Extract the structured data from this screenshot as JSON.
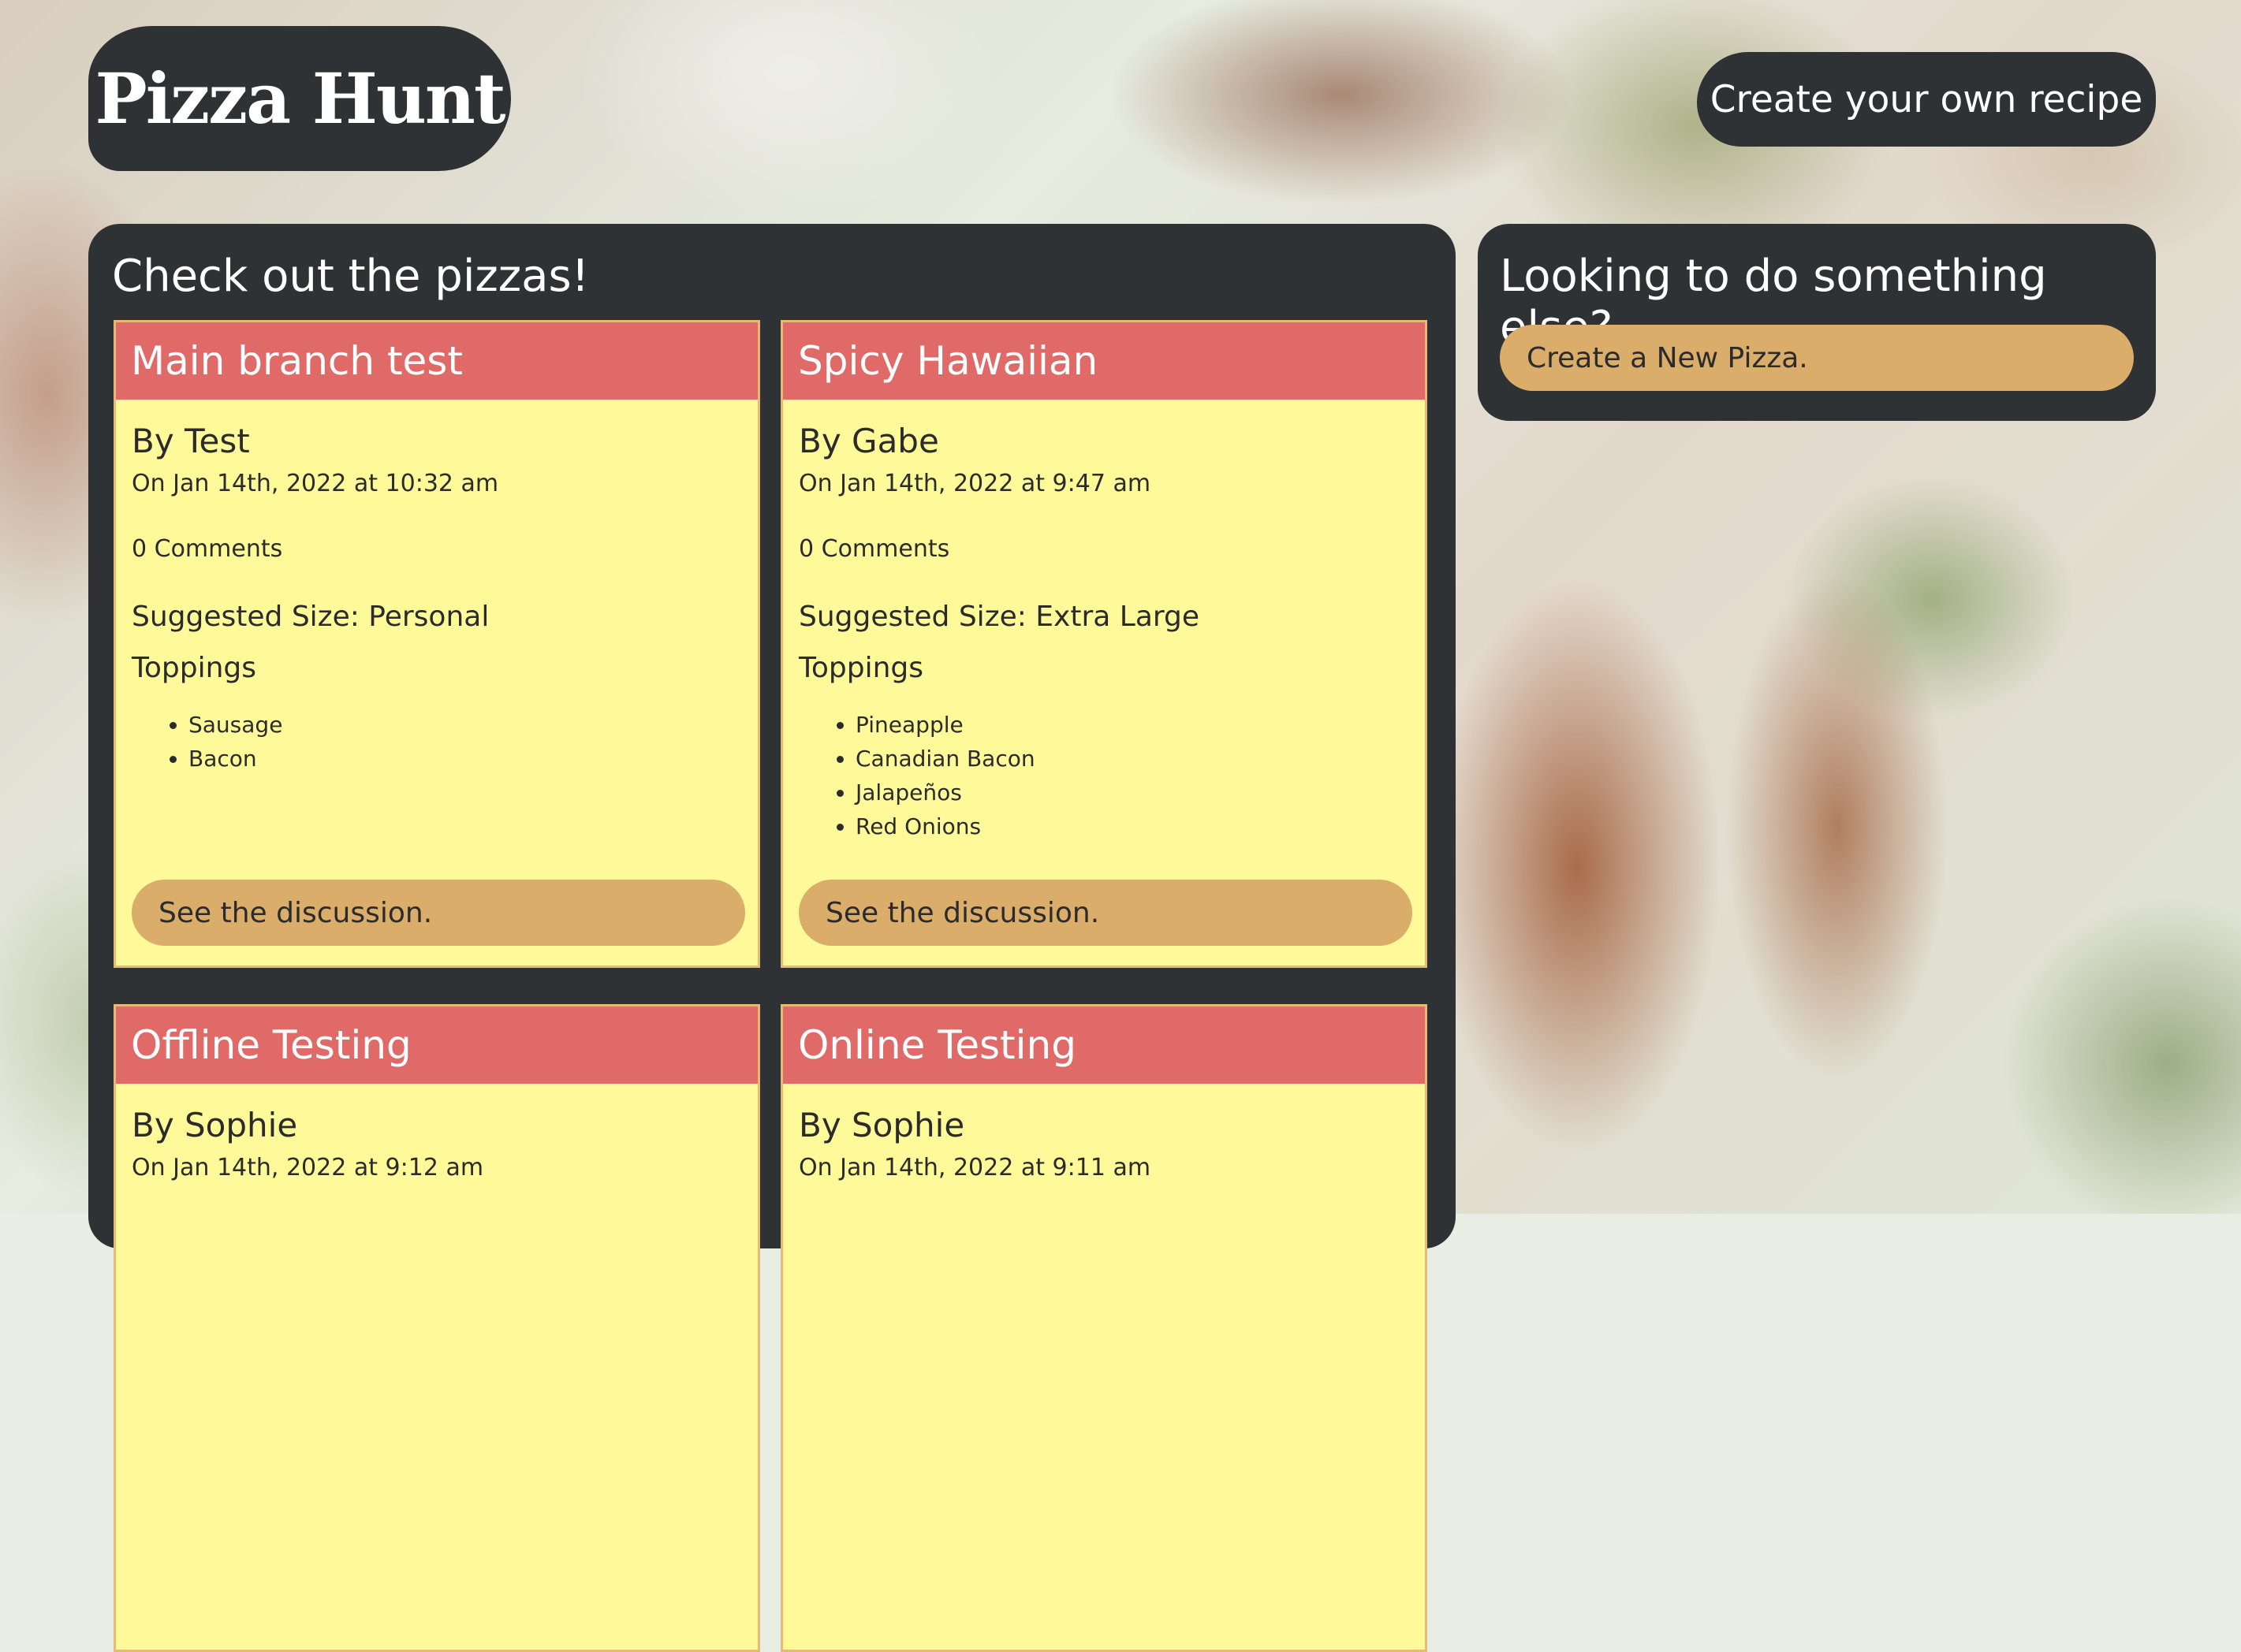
{
  "header": {
    "logo": "Pizza Hunt",
    "create_recipe_label": "Create your own recipe"
  },
  "main": {
    "title": "Check out the pizzas!",
    "pizzas": [
      {
        "name": "Main branch test",
        "author": "By Test",
        "date": "On Jan 14th, 2022 at 10:32 am",
        "comments": "0 Comments",
        "size": "Suggested Size: Personal",
        "toppings_label": "Toppings",
        "toppings": [
          "Sausage",
          "Bacon"
        ],
        "discussion_label": "See the discussion."
      },
      {
        "name": "Spicy Hawaiian",
        "author": "By Gabe",
        "date": "On Jan 14th, 2022 at 9:47 am",
        "comments": "0 Comments",
        "size": "Suggested Size: Extra Large",
        "toppings_label": "Toppings",
        "toppings": [
          "Pineapple",
          "Canadian Bacon",
          "Jalapeños",
          "Red Onions"
        ],
        "discussion_label": "See the discussion."
      },
      {
        "name": "Offline Testing",
        "author": "By Sophie",
        "date": "On Jan 14th, 2022 at 9:12 am"
      },
      {
        "name": "Online Testing",
        "author": "By Sophie",
        "date": "On Jan 14th, 2022 at 9:11 am"
      }
    ]
  },
  "sidebar": {
    "title": "Looking to do something else?",
    "new_pizza_label": "Create a New Pizza."
  },
  "colors": {
    "panel": "#2f3235",
    "card_header": "#e06a68",
    "card_body": "#fffa99",
    "button": "#dbad6a"
  }
}
